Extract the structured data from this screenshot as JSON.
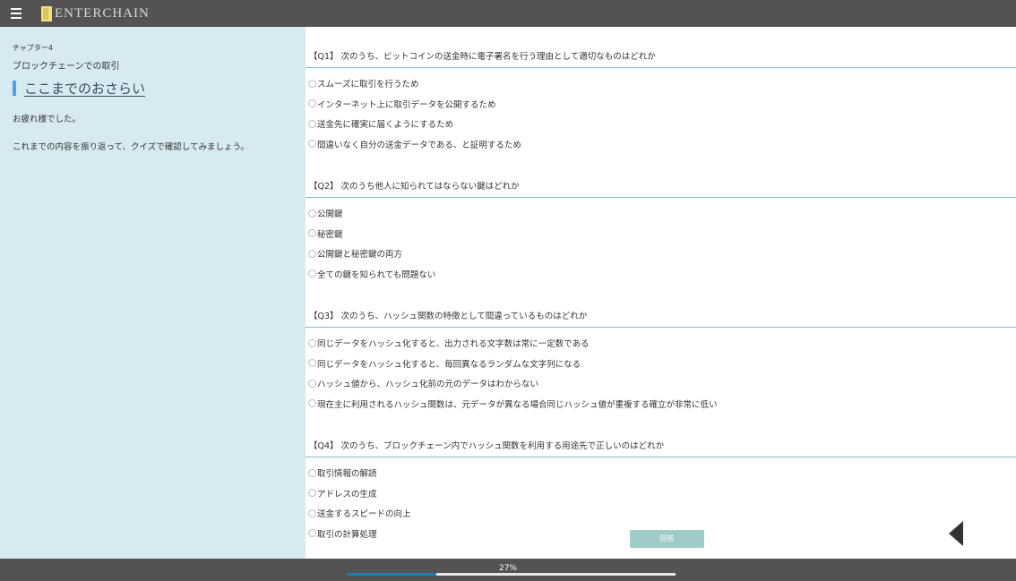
{
  "header": {
    "logo_text": "ENTERCHAIN"
  },
  "sidebar": {
    "chapter": "チャプター4",
    "chapter_title": "ブロックチェーンでの取引",
    "section_title": "ここまでのおさらい",
    "paragraphs": [
      "お疲れ様でした。",
      "これまでの内容を振り返って、クイズで確認してみましょう。"
    ]
  },
  "questions": [
    {
      "title": "【Q1】 次のうち、ビットコインの送金時に電子署名を行う理由として適切なものはどれか",
      "options": [
        "スムーズに取引を行うため",
        "インターネット上に取引データを公開するため",
        "送金先に確実に届くようにするため",
        "間違いなく自分の送金データである、と証明するため"
      ]
    },
    {
      "title": "【Q2】 次のうち他人に知られてはならない鍵はどれか",
      "options": [
        "公開鍵",
        "秘密鍵",
        "公開鍵と秘密鍵の両方",
        "全ての鍵を知られても問題ない"
      ]
    },
    {
      "title": "【Q3】 次のうち、ハッシュ関数の特徴として間違っているものはどれか",
      "options": [
        "同じデータをハッシュ化すると、出力される文字数は常に一定数である",
        "同じデータをハッシュ化すると、毎回異なるランダムな文字列になる",
        "ハッシュ値から、ハッシュ化前の元のデータはわからない",
        "現在主に利用されるハッシュ関数は、元データが異なる場合同じハッシュ値が重複する確立が非常に低い"
      ]
    },
    {
      "title": "【Q4】 次のうち、ブロックチェーン内でハッシュ関数を利用する用途先で正しいのはどれか",
      "options": [
        "取引情報の解読",
        "アドレスの生成",
        "送金するスピードの向上",
        "取引の計算処理"
      ]
    }
  ],
  "answer_button": "回答",
  "progress": {
    "label": "27%",
    "value": 0.27
  },
  "icons": {
    "menu": "hamburger-menu-icon",
    "back": "back-arrow-icon"
  }
}
